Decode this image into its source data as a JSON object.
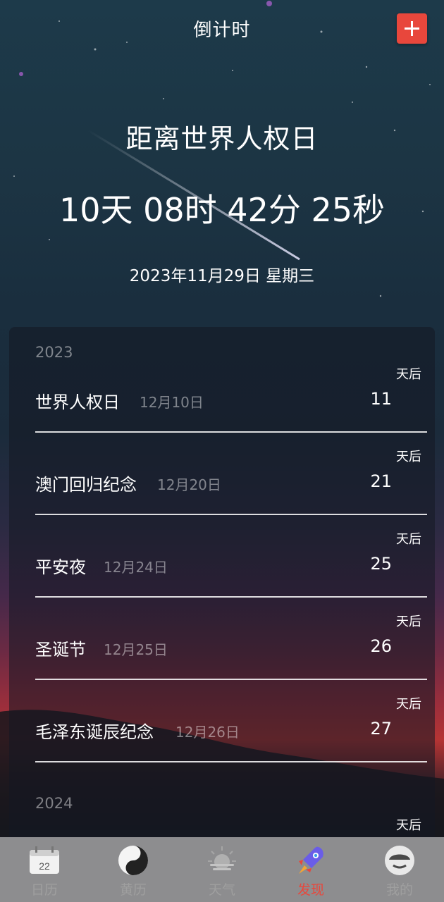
{
  "header": {
    "title": "倒计时",
    "add_icon": "plus-icon"
  },
  "hero": {
    "event_title": "距离世界人权日",
    "countdown": "10天 08时 42分 25秒",
    "current_date": "2023年11月29日 星期三"
  },
  "events": {
    "groups": [
      {
        "year": "2023",
        "items": [
          {
            "name": "世界人权日",
            "date": "12月10日",
            "days": "11",
            "suffix": "天后"
          },
          {
            "name": "澳门回归纪念",
            "date": "12月20日",
            "days": "21",
            "suffix": "天后"
          },
          {
            "name": "平安夜",
            "date": "12月24日",
            "days": "25",
            "suffix": "天后"
          },
          {
            "name": "圣诞节",
            "date": "12月25日",
            "days": "26",
            "suffix": "天后"
          },
          {
            "name": "毛泽东诞辰纪念",
            "date": "12月26日",
            "days": "27",
            "suffix": "天后"
          }
        ]
      },
      {
        "year": "2024",
        "items": [
          {
            "name": "",
            "date": "",
            "days": "",
            "suffix": "天后"
          }
        ]
      }
    ]
  },
  "tabbar": {
    "tabs": [
      {
        "label": "日历",
        "icon": "calendar-icon",
        "icon_text": "22",
        "active": false
      },
      {
        "label": "黄历",
        "icon": "yin-yang-icon",
        "active": false
      },
      {
        "label": "天气",
        "icon": "sun-cloud-icon",
        "active": false
      },
      {
        "label": "发现",
        "icon": "rocket-icon",
        "active": true
      },
      {
        "label": "我的",
        "icon": "profile-face-icon",
        "active": false
      }
    ]
  },
  "colors": {
    "accent": "#e8473c",
    "tabbar_bg": "#8d8d8f",
    "inactive_tab": "#9f9f9f"
  }
}
